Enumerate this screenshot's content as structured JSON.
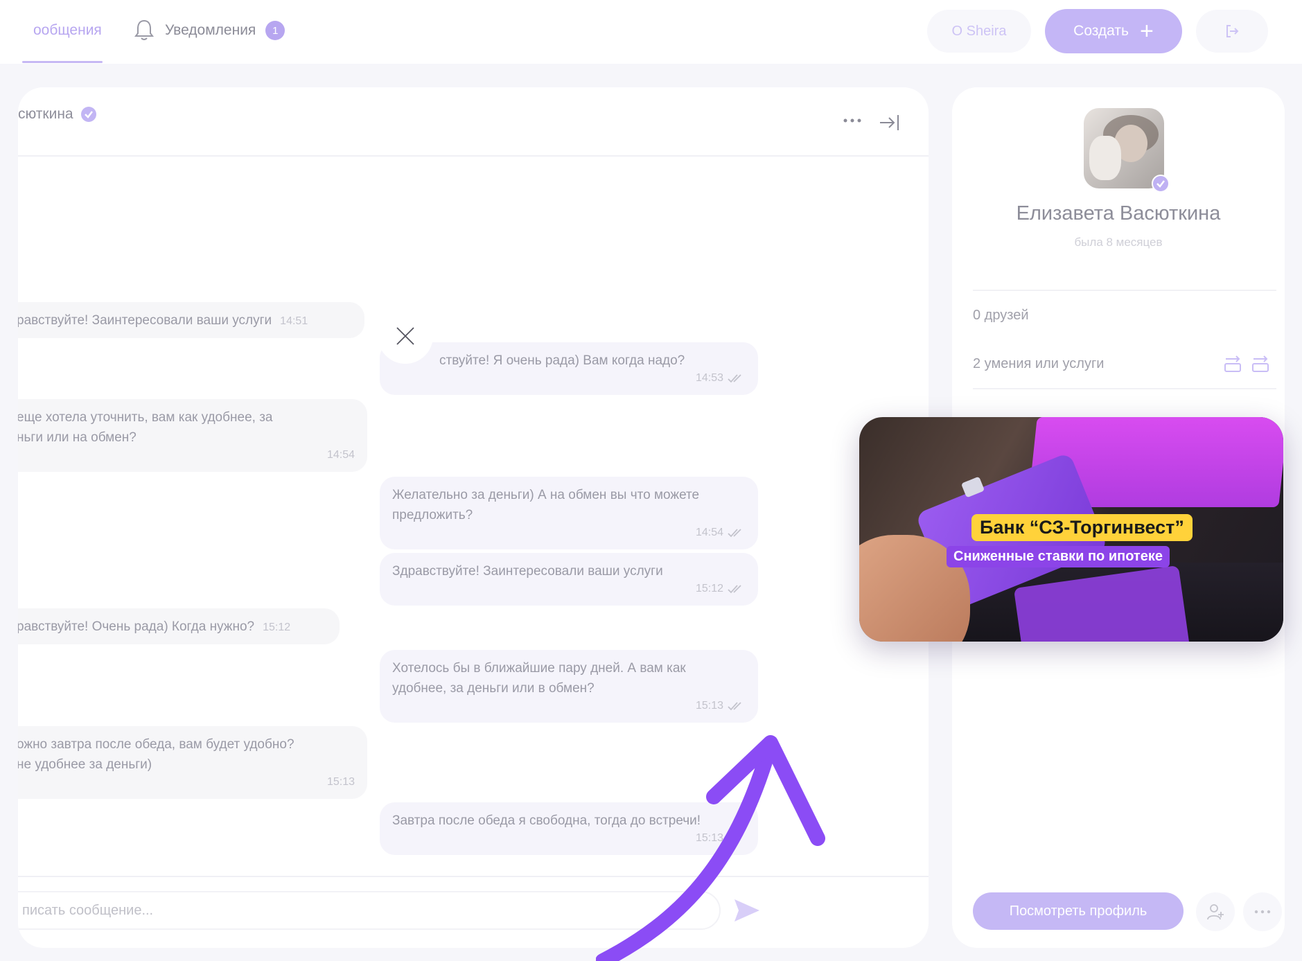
{
  "topbar": {
    "tab_messages": "ообщения",
    "tab_notifications": "Уведомления",
    "notifications_count": "1",
    "about_label": "О Sheira",
    "create_label": "Создать",
    "logout_icon": "logout-icon"
  },
  "chat": {
    "header_name": "сюткина",
    "messages": [
      {
        "dir": "in",
        "lines": [
          "равствуйте! Заинтересовали ваши услуги"
        ],
        "time": "14:51"
      },
      {
        "dir": "out",
        "lines": [
          "ствуйте! Я очень рада) Вам когда надо?"
        ],
        "time": "14:53"
      },
      {
        "dir": "in",
        "lines": [
          "еще хотела уточнить, вам как удобнее, за",
          "ньги или на обмен?"
        ],
        "time": "14:54"
      },
      {
        "dir": "out",
        "lines": [
          "Желательно за деньги) А на обмен вы что можете",
          "предложить?"
        ],
        "time": "14:54"
      },
      {
        "dir": "out",
        "lines": [
          "Здравствуйте! Заинтересовали ваши услуги"
        ],
        "time": "15:12"
      },
      {
        "dir": "in",
        "lines": [
          "равствуйте! Очень рада) Когда нужно?"
        ],
        "time": "15:12"
      },
      {
        "dir": "out",
        "lines": [
          "Хотелось бы в ближайшие пару дней. А вам как",
          "удобнее, за деньги или в обмен?"
        ],
        "time": "15:13"
      },
      {
        "dir": "in",
        "lines": [
          "ожно завтра после обеда, вам будет удобно?",
          "не удобнее за деньги)"
        ],
        "time": "15:13"
      },
      {
        "dir": "out",
        "lines": [
          "Завтра после обеда я свободна, тогда до встречи!"
        ],
        "time": "15:13"
      }
    ],
    "input_placeholder": "писать сообщение..."
  },
  "profile": {
    "name": "Елизавета Васюткина",
    "status": "была 8 месяцев",
    "friends": "0 друзей",
    "skills": "2 умения или услуги",
    "view_profile_label": "Посмотреть профиль"
  },
  "promo": {
    "title": "Банк “СЗ-Торгинвест”",
    "subtitle": "Сниженные ставки по ипотеке"
  },
  "colors": {
    "accent": "#c4b6f6",
    "arrow": "#8b4cf5",
    "promo_yellow": "#ffd23a",
    "promo_purple": "#8c44e8"
  }
}
